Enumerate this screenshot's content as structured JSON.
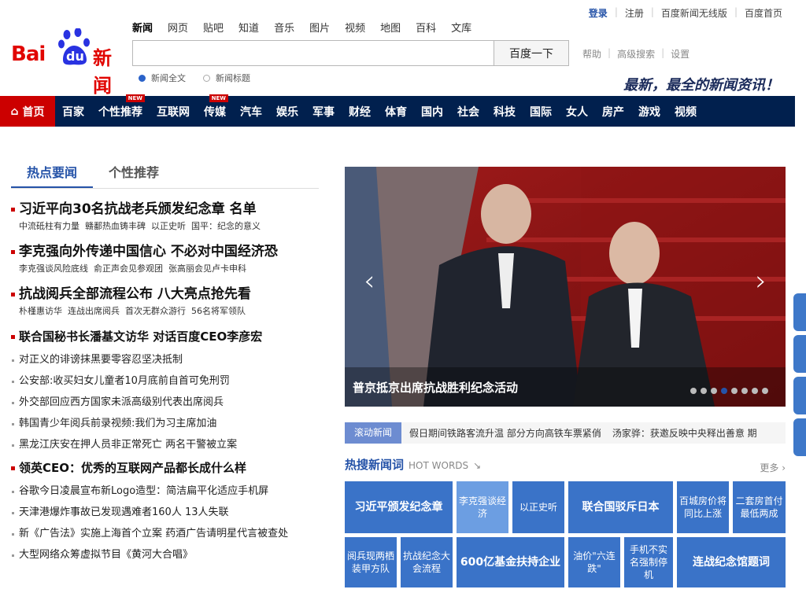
{
  "header": {
    "logo_text": "Bai du 新闻",
    "tabs": [
      {
        "label": "新闻",
        "active": true
      },
      {
        "label": "网页"
      },
      {
        "label": "贴吧"
      },
      {
        "label": "知道"
      },
      {
        "label": "音乐"
      },
      {
        "label": "图片"
      },
      {
        "label": "视频"
      },
      {
        "label": "地图"
      },
      {
        "label": "百科"
      },
      {
        "label": "文库"
      }
    ],
    "search_value": "",
    "search_button": "百度一下",
    "radio_full": "新闻全文",
    "radio_title": "新闻标题",
    "help_links": [
      "帮助",
      "高级搜索",
      "设置"
    ],
    "top_links": {
      "login": "登录",
      "register": "注册",
      "wireless": "百度新闻无线版",
      "home": "百度首页"
    },
    "slogan": "最新，最全的新闻资讯！"
  },
  "nav": {
    "items": [
      {
        "label": "首页",
        "home": true
      },
      {
        "label": "百家"
      },
      {
        "label": "个性推荐",
        "badge": "NEW"
      },
      {
        "label": "互联网"
      },
      {
        "label": "传媒",
        "badge": "NEW"
      },
      {
        "label": "汽车"
      },
      {
        "label": "娱乐"
      },
      {
        "label": "军事"
      },
      {
        "label": "财经"
      },
      {
        "label": "体育"
      },
      {
        "label": "国内"
      },
      {
        "label": "社会"
      },
      {
        "label": "科技"
      },
      {
        "label": "国际"
      },
      {
        "label": "女人"
      },
      {
        "label": "房产"
      },
      {
        "label": "游戏"
      },
      {
        "label": "视频"
      }
    ]
  },
  "left": {
    "tabs": [
      "热点要闻",
      "个性推荐"
    ],
    "stories": [
      {
        "headline": "习近平向30名抗战老兵颁发纪念章 名单",
        "subs": [
          "中流砥柱有力量",
          "赣鄱热血铸丰碑",
          "以正史听",
          "国平：纪念的意义"
        ]
      },
      {
        "headline": "李克强向外传递中国信心 不必对中国经济恐",
        "subs": [
          "李克强谈风险底线",
          "俞正声会见参观团",
          "张高丽会见卢卡申科"
        ]
      },
      {
        "headline": "抗战阅兵全部流程公布 八大亮点抢先看",
        "subs": [
          "朴槿惠访华",
          "连战出席阅兵",
          "首次无群众游行",
          "56名将军领队"
        ]
      }
    ],
    "section2_headline": "联合国秘书长潘基文访华 对话百度CEO李彦宏",
    "list1": [
      "对正义的诽谤抹黑要零容忍坚决抵制",
      "公安部:收买妇女儿童者10月底前自首可免刑罚",
      "外交部回应西方国家未派高级别代表出席阅兵",
      "韩国青少年阅兵前录视频:我们为习主席加油",
      "黑龙江庆安在押人员非正常死亡 两名干警被立案"
    ],
    "section3_headline": "领英CEO：优秀的互联网产品都长成什么样",
    "list2": [
      "谷歌今日凌晨宣布新Logo造型：简洁扁平化适应手机屏",
      "天津港爆炸事故已发现遇难者160人 13人失联",
      "新《广告法》实施上海首个立案 药酒广告请明星代言被查处",
      "大型网络众筹虚拟节目《黄河大合唱》"
    ]
  },
  "slider": {
    "caption": "普京抵京出席抗战胜利纪念活动",
    "dot_count": 8,
    "active_dot": 4
  },
  "rolling": {
    "label": "滚动新闻",
    "items": [
      "假日期间铁路客流升温 部分方向高铁车票紧俏",
      "汤家骅：获邀反映中央释出善意 期"
    ]
  },
  "hot": {
    "title": "热搜新闻词",
    "eng": "HOT WORDS",
    "more": "更多",
    "cells": [
      "习近平颁发纪念章",
      "李克强谈经济",
      "以正史听",
      "联合国驳斥日本",
      "百城房价将同比上涨",
      "二套房首付最低两成",
      "阅兵现两栖装甲方队",
      "抗战纪念大会流程",
      "600亿基金扶持企业",
      "油价\"六连跌\"",
      "手机不实名强制停机",
      "连战纪念馆题词"
    ]
  },
  "colors": {
    "brand_red": "#e10602",
    "nav_bg": "#01204e",
    "accent_blue": "#2553a8"
  }
}
